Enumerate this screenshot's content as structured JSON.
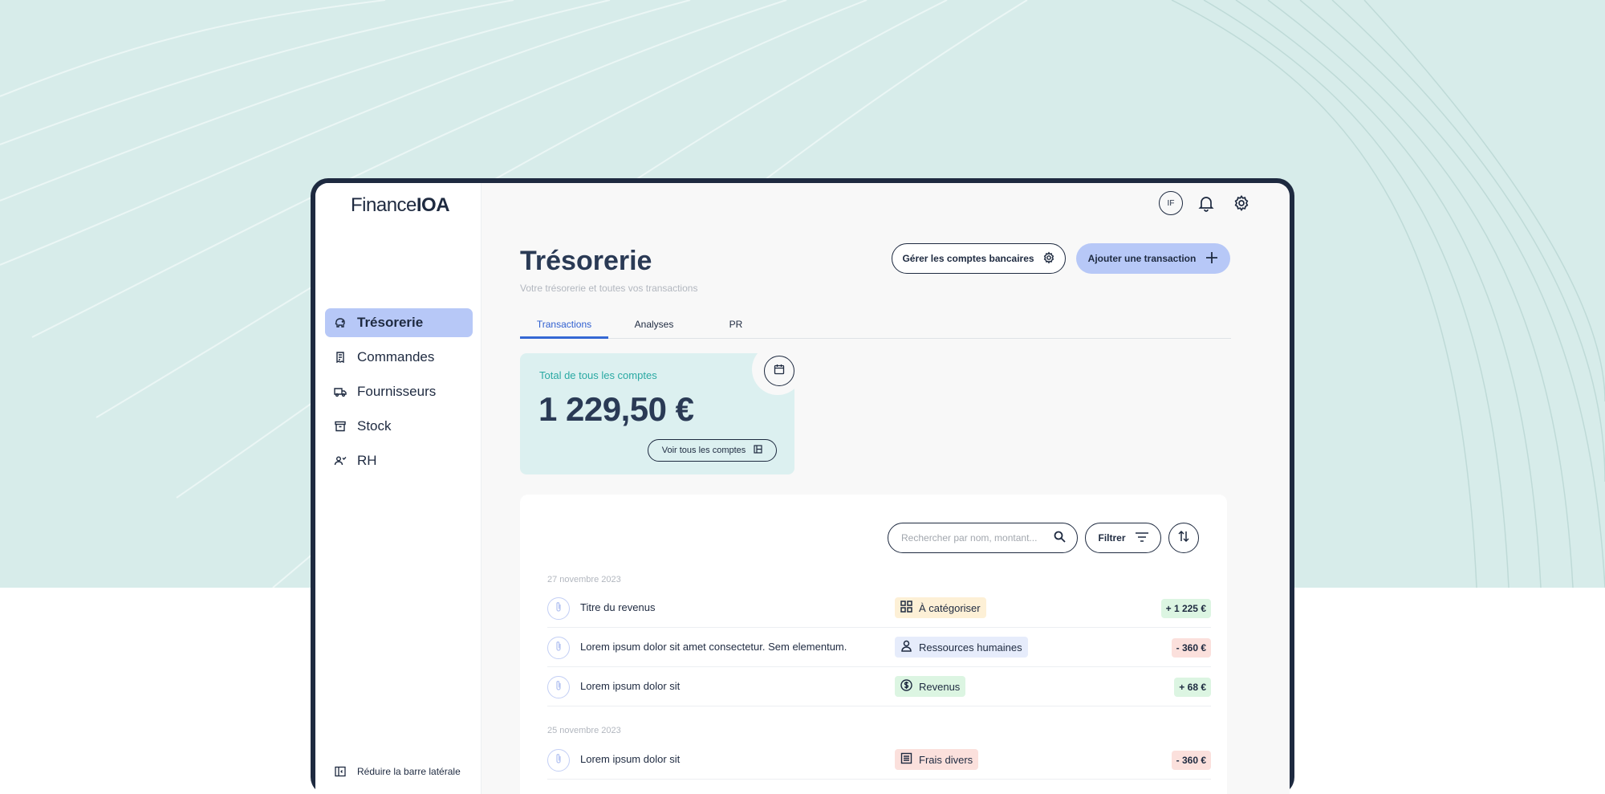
{
  "brand": {
    "part1": "Finance",
    "part2": "IOA"
  },
  "topbar": {
    "avatar_initials": "IF",
    "bell_icon": "bell-icon",
    "settings_icon": "gear-icon"
  },
  "sidebar": {
    "items": [
      {
        "label": "Trésorerie",
        "icon": "piggy-bank-icon",
        "active": true
      },
      {
        "label": "Commandes",
        "icon": "receipt-icon",
        "active": false
      },
      {
        "label": "Fournisseurs",
        "icon": "truck-icon",
        "active": false
      },
      {
        "label": "Stock",
        "icon": "archive-icon",
        "active": false
      },
      {
        "label": "RH",
        "icon": "users-icon",
        "active": false
      }
    ],
    "collapse_label": "Réduire la barre latérale"
  },
  "header": {
    "title": "Trésorerie",
    "subtitle": "Votre trésorerie et toutes vos transactions",
    "manage_button": "Gérer les comptes bancaires",
    "add_button": "Ajouter une transaction"
  },
  "tabs": [
    {
      "label": "Transactions",
      "active": true
    },
    {
      "label": "Analyses",
      "active": false
    },
    {
      "label": "PR",
      "active": false
    }
  ],
  "total_card": {
    "label": "Total de tous les comptes",
    "value": "1 229,50 €",
    "see_all": "Voir tous les comptes"
  },
  "toolbar": {
    "search_placeholder": "Rechercher par nom, montant...",
    "filter_label": "Filtrer"
  },
  "groups": [
    {
      "date": "27 novembre 2023",
      "rows": [
        {
          "title": "Titre du revenus",
          "category": "À catégoriser",
          "category_icon": "grid-icon",
          "amount": "+ 1 225 €",
          "type": "income"
        },
        {
          "title": "Lorem ipsum dolor sit amet consectetur. Sem elementum.",
          "category": "Ressources humaines",
          "category_icon": "person-icon",
          "amount": "- 360 €",
          "type": "expense"
        },
        {
          "title": "Lorem ipsum dolor sit",
          "category": "Revenus",
          "category_icon": "dollar-icon",
          "amount": "+ 68 €",
          "type": "income"
        }
      ]
    },
    {
      "date": "25 novembre 2023",
      "rows": [
        {
          "title": "Lorem ipsum dolor sit",
          "category": "Frais divers",
          "category_icon": "list-icon",
          "amount": "- 360 €",
          "type": "expense"
        }
      ]
    }
  ],
  "colors": {
    "accent": "#b7c8f7",
    "navy": "#1e2a40",
    "teal_card": "#dcf0f0",
    "income_bg": "#dcf5e2",
    "expense_bg": "#fbe0dc",
    "cat_uncategorized": "#fdf0d6",
    "cat_hr": "#e6ecfb",
    "cat_revenue": "#dcf5e2",
    "cat_misc": "#fbe0dc"
  }
}
